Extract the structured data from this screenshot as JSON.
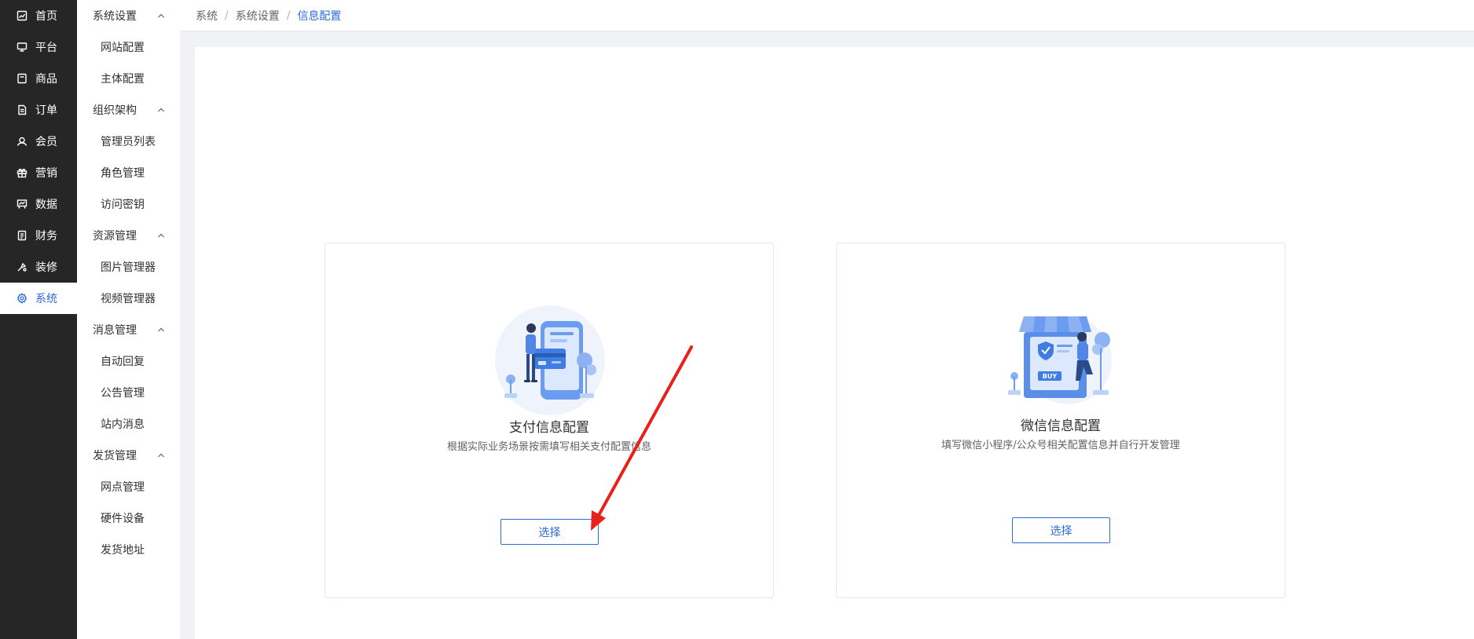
{
  "primary_nav": [
    {
      "label": "首页",
      "icon": "dashboard-icon",
      "active": false
    },
    {
      "label": "平台",
      "icon": "monitor-icon",
      "active": false
    },
    {
      "label": "商品",
      "icon": "product-icon",
      "active": false
    },
    {
      "label": "订单",
      "icon": "order-icon",
      "active": false
    },
    {
      "label": "会员",
      "icon": "member-icon",
      "active": false
    },
    {
      "label": "营销",
      "icon": "gift-icon",
      "active": false
    },
    {
      "label": "数据",
      "icon": "chart-board-icon",
      "active": false
    },
    {
      "label": "财务",
      "icon": "finance-icon",
      "active": false
    },
    {
      "label": "装修",
      "icon": "decoration-icon",
      "active": false
    },
    {
      "label": "系统",
      "icon": "gear-icon",
      "active": true
    }
  ],
  "sub_nav": {
    "groups": [
      {
        "title": "系统设置",
        "items": [
          "网站配置",
          "主体配置"
        ]
      },
      {
        "title": "组织架构",
        "items": [
          "管理员列表",
          "角色管理",
          "访问密钥"
        ]
      },
      {
        "title": "资源管理",
        "items": [
          "图片管理器",
          "视频管理器"
        ]
      },
      {
        "title": "消息管理",
        "items": [
          "自动回复",
          "公告管理",
          "站内消息"
        ]
      },
      {
        "title": "发货管理",
        "items": [
          "网点管理",
          "硬件设备",
          "发货地址"
        ]
      }
    ]
  },
  "breadcrumb": [
    "系统",
    "系统设置",
    "信息配置"
  ],
  "breadcrumb_separator": "/",
  "cards": [
    {
      "title": "支付信息配置",
      "description": "根据实际业务场景按需填写相关支付配置信息",
      "button": "选择",
      "illustration": "payment-illustration"
    },
    {
      "title": "微信信息配置",
      "description": "填写微信小程序/公众号相关配置信息并自行开发管理",
      "button": "选择",
      "illustration": "wechat-shop-illustration"
    }
  ],
  "colors": {
    "accent": "#2d6bd9",
    "sidebar_dark": "#262626",
    "annotation_arrow": "#e8211b"
  }
}
